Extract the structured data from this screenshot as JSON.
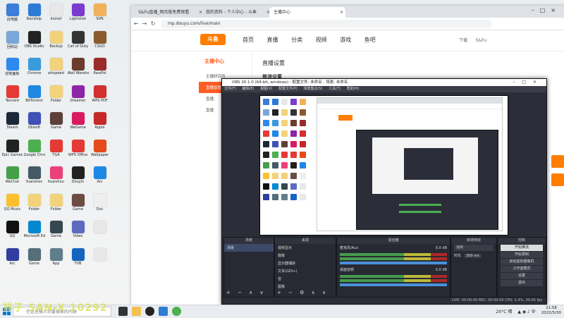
{
  "desktop": {
    "icons": [
      {
        "label": "此电脑",
        "color": "#3b7dd8"
      },
      {
        "label": "Bandizip",
        "color": "#2e7bd6"
      },
      {
        "label": "Inonet",
        "color": "#e8e8e8"
      },
      {
        "label": "Lightshot",
        "color": "#7a3bd0"
      },
      {
        "label": "SVN",
        "color": "#f2b05a"
      },
      {
        "label": "回收站",
        "color": "#7aa7d8"
      },
      {
        "label": "OBS Studio",
        "color": "#222222"
      },
      {
        "label": "Backup",
        "color": "#f2d27a"
      },
      {
        "label": "Call of Duty",
        "color": "#333333"
      },
      {
        "label": "CSGO",
        "color": "#8b5a2b"
      },
      {
        "label": "控制面板",
        "color": "#2d89ef"
      },
      {
        "label": "Chrome",
        "color": "#3a9bdc"
      },
      {
        "label": "afxspeed",
        "color": "#f2d27a"
      },
      {
        "label": "Wall Warehouse",
        "color": "#6b3b2b"
      },
      {
        "label": "PassPol",
        "color": "#9b2b2b"
      },
      {
        "label": "Tencent",
        "color": "#e53935"
      },
      {
        "label": "BitTorrent",
        "color": "#1e88e5"
      },
      {
        "label": "Folder",
        "color": "#f2d27a"
      },
      {
        "label": "Dreamer",
        "color": "#8e24aa"
      },
      {
        "label": "WPS PDF",
        "color": "#d32f2f"
      },
      {
        "label": "Steam",
        "color": "#1b2838"
      },
      {
        "label": "Ubisoft",
        "color": "#3f51b5"
      },
      {
        "label": "Game",
        "color": "#5d4037"
      },
      {
        "label": "WeGame",
        "color": "#d81b60"
      },
      {
        "label": "Apple",
        "color": "#c62828"
      },
      {
        "label": "Epic Games",
        "color": "#222222"
      },
      {
        "label": "Google Chrome",
        "color": "#4caf50"
      },
      {
        "label": "TGA",
        "color": "#e53935"
      },
      {
        "label": "WPS Office",
        "color": "#e53935"
      },
      {
        "label": "Wallpaper",
        "color": "#e64a19"
      },
      {
        "label": "WeChat",
        "color": "#43a047"
      },
      {
        "label": "Yuanshen",
        "color": "#455a64"
      },
      {
        "label": "Kuaishou",
        "color": "#ec407a"
      },
      {
        "label": "Douyin",
        "color": "#212121"
      },
      {
        "label": "Arc",
        "color": "#1e88e5"
      },
      {
        "label": "QQ Music",
        "color": "#fbc02d"
      },
      {
        "label": "Folder",
        "color": "#f2d27a"
      },
      {
        "label": "Folder",
        "color": "#f2d27a"
      },
      {
        "label": "Game",
        "color": "#6d4c41"
      },
      {
        "label": "Doc",
        "color": "#eeeeee"
      },
      {
        "label": "QQ",
        "color": "#111111"
      },
      {
        "label": "Microsoft Edge",
        "color": "#0288d1"
      },
      {
        "label": "Game",
        "color": "#37474f"
      },
      {
        "label": "Video",
        "color": "#5c6bc0"
      },
      {
        "label": "",
        "color": "#e8e8e8"
      },
      {
        "label": "Arc",
        "color": "#303f9f"
      },
      {
        "label": "Game",
        "color": "#546e7a"
      },
      {
        "label": "App",
        "color": "#607d8b"
      },
      {
        "label": "TVB",
        "color": "#1565c0"
      },
      {
        "label": "",
        "color": "#e8e8e8"
      }
    ]
  },
  "browser": {
    "tabs": [
      {
        "label": "S&Fu直播_网页版免费观看"
      },
      {
        "label": "我的资料 - 个人中心 - 斗鱼"
      },
      {
        "label": "主播中心"
      }
    ],
    "url": "mp.douyu.com/live/main",
    "site": {
      "logo": "斗鱼",
      "menu": [
        "首页",
        "直播",
        "分类",
        "视频",
        "游戏",
        "鱼吧"
      ],
      "user": "S&Fu",
      "download": "下载"
    },
    "sidebar": {
      "title": "主播中心",
      "items": [
        {
          "label": "主播研究所",
          "active": false
        },
        {
          "label": "直播设置",
          "active": true
        },
        {
          "label": "直播",
          "active": false
        },
        {
          "label": "直播",
          "active": false
        }
      ]
    },
    "content": {
      "title": "直播设置",
      "subtitle": "推流设置"
    }
  },
  "obs": {
    "title": "OBS 26.1.0 (64-bit, windows) - 配置文件: 未命名 - 场景: 未命名",
    "menu": [
      "文件(F)",
      "编辑(E)",
      "视图(V)",
      "配置文件(P)",
      "场景集合(S)",
      "工具(T)",
      "帮助(H)"
    ],
    "docks": {
      "scenes": {
        "title": "场景",
        "items": [
          "场景"
        ]
      },
      "sources": {
        "title": "来源",
        "items": [
          "视频显示",
          "摄像",
          "显示器捕获",
          "文本(GDI+)",
          "音",
          "图像"
        ]
      },
      "mixer": {
        "title": "混音器",
        "items": [
          {
            "name": "麦克风/Aux",
            "level": "0.0 dB"
          },
          {
            "name": "桌面音频",
            "level": "0.0 dB"
          }
        ]
      },
      "transitions": {
        "title": "转场特效",
        "type": "淡出",
        "duration_label": "时长",
        "duration": "300 ms"
      },
      "controls": {
        "title": "控制",
        "buttons": [
          {
            "label": "开始推流",
            "on": true
          },
          {
            "label": "开始录制",
            "on": false
          },
          {
            "label": "启动虚拟摄像机",
            "on": false
          },
          {
            "label": "工作室模式",
            "on": false
          },
          {
            "label": "设置",
            "on": false
          },
          {
            "label": "退出",
            "on": false
          }
        ]
      }
    },
    "status": "LIVE: 00:00:00  REC: 00:00:00  CPU: 1.4%, 30.00 fps"
  },
  "taskbar": {
    "search_placeholder": "在这里输入你要搜索的内容",
    "weather": "20°C 晴",
    "time": "21:58",
    "date": "2022/5/30"
  },
  "watermark": "祥子  SAN-X  10292"
}
